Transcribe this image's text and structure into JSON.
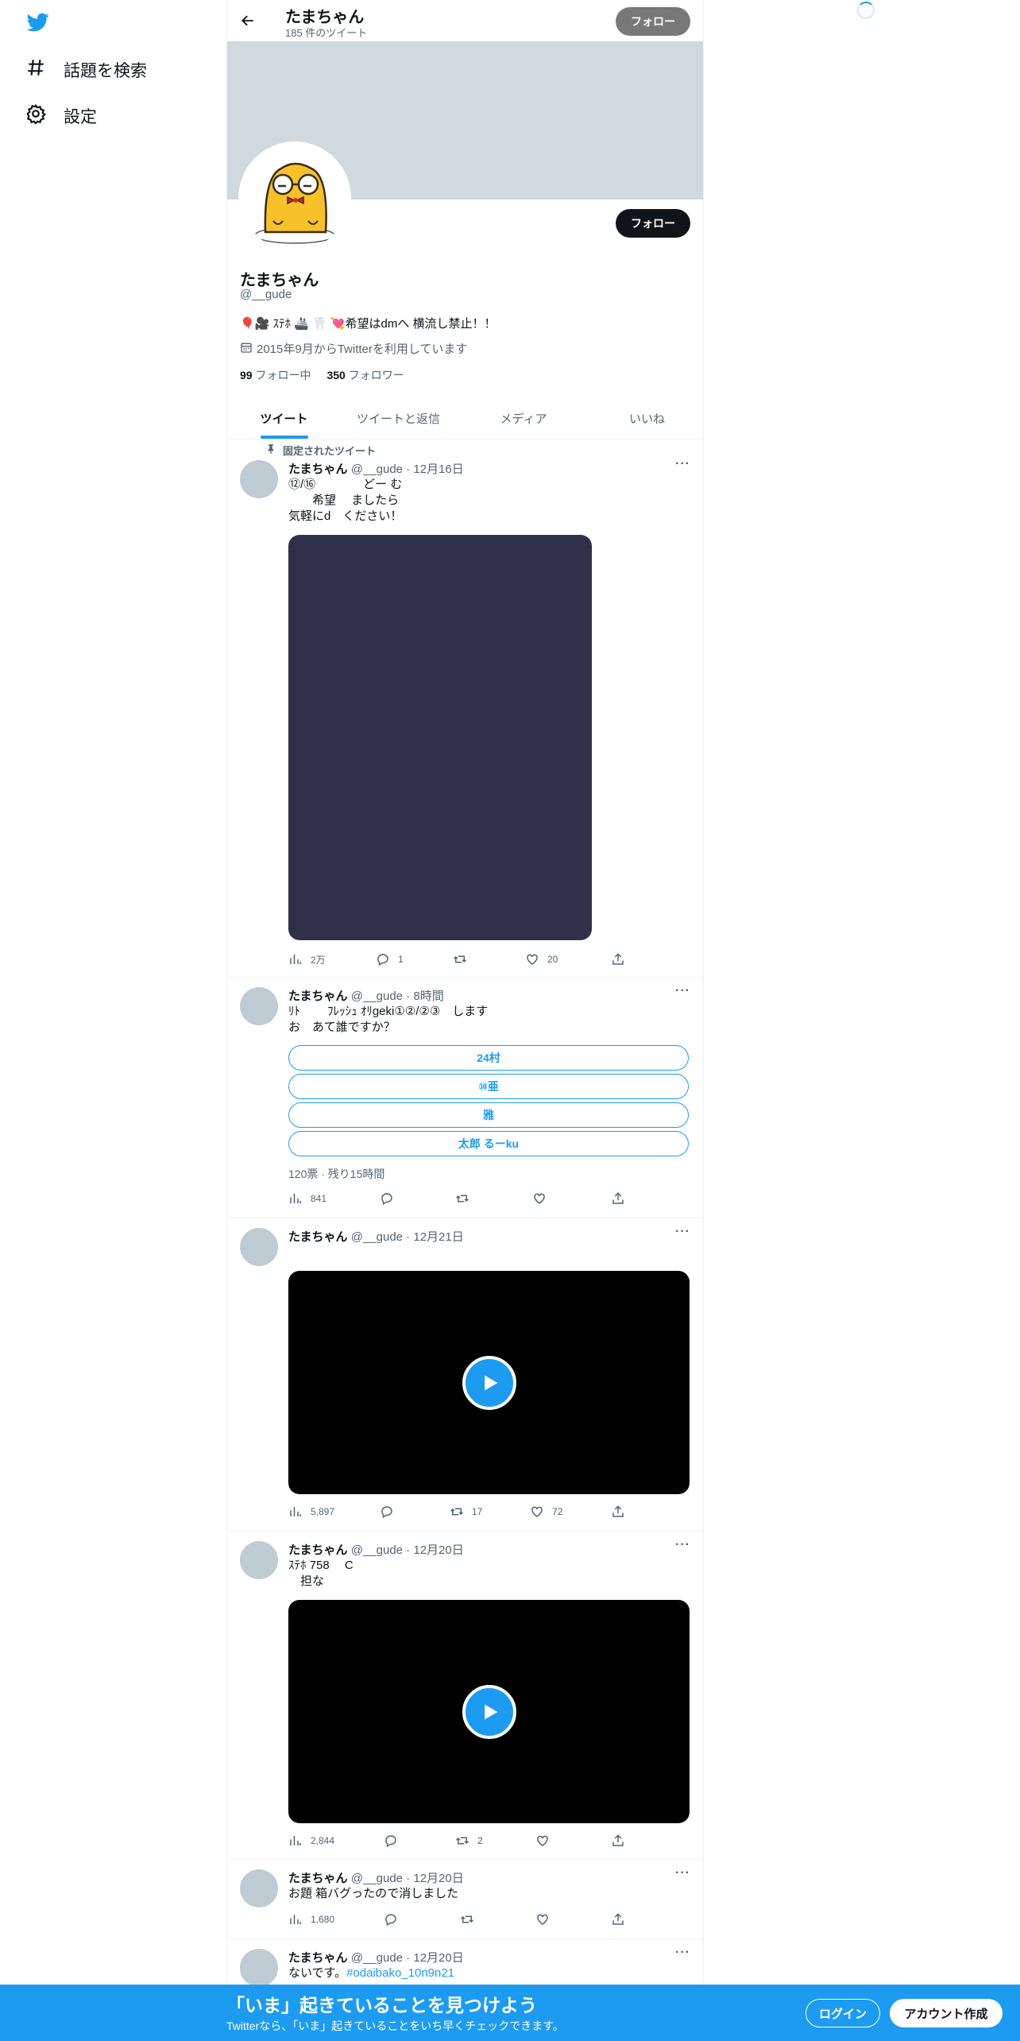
{
  "nav": {
    "explore_label": "話題を検索",
    "settings_label": "設定"
  },
  "header": {
    "name": "たまちゃん",
    "tweet_count": "185 件のツイート",
    "follow_label": "フォロー"
  },
  "profile": {
    "follow_label": "フォロー",
    "name": "たまちゃん",
    "handle": "@__gude",
    "bio": "🎈🎥 ｽﾃﾎ 🚢 🦷 💘希望はdmへ 横流し禁止！！",
    "joined": "2015年9月からTwitterを利用しています",
    "following_count": "99",
    "following_label": "フォロー中",
    "followers_count": "350",
    "followers_label": "フォロワー"
  },
  "tabs": [
    "ツイート",
    "ツイートと返信",
    "メディア",
    "いいね"
  ],
  "tweets": [
    {
      "pinned_label": "固定されたツイート",
      "name": "たまちゃん",
      "meta": "@__gude · 12月16日",
      "text": "⑫/⑯　　　　どー む\n　　希望　 ましたら\n気軽にd　ください！",
      "views": "2万",
      "replies": "1",
      "retweets": "",
      "likes": "20"
    },
    {
      "name": "たまちゃん",
      "meta": "@__gude · 8時間",
      "text": "ﾘﾄ　　 ﾌﾚｯｼｭ ｵﾘgeki①②/②③　します\nお　あて誰ですか？",
      "poll": [
        "24村",
        "⑩亜",
        "雅",
        "太郎 るーku"
      ],
      "poll_meta": "120票 · 残り15時間",
      "views": "841",
      "replies": "",
      "retweets": "",
      "likes": ""
    },
    {
      "name": "たまちゃん",
      "meta": "@__gude · 12月21日",
      "views": "5,897",
      "replies": "",
      "retweets": "17",
      "likes": "72"
    },
    {
      "name": "たまちゃん",
      "meta": "@__gude · 12月20日",
      "text": "ｽﾃﾎ 758　 C\n　担な",
      "views": "2,844",
      "replies": "",
      "retweets": "2",
      "likes": ""
    },
    {
      "name": "たまちゃん",
      "meta": "@__gude · 12月20日",
      "text": "お題 箱バグったので消しました",
      "views": "1,680",
      "replies": "",
      "retweets": "",
      "likes": ""
    },
    {
      "name": "たまちゃん",
      "meta": "@__gude · 12月20日",
      "text_prefix": "ないです。",
      "hashtag": "#odaibako_10n9n21"
    }
  ],
  "bottom": {
    "title": "「いま」起きていることを見つけよう",
    "subtitle": "Twitterなら、「いま」起きていることをいち早くチェックできます。",
    "login_label": "ログイン",
    "signup_label": "アカウント作成"
  },
  "colors": {
    "accent": "#1d9bf0",
    "banner": "#cfd9de",
    "media": "#2f3049"
  }
}
